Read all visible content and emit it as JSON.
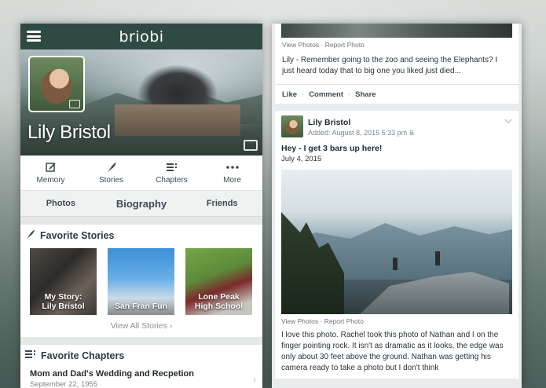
{
  "left": {
    "logo": "briobi",
    "profile_name": "Lily Bristol",
    "actions": [
      {
        "label": "Memory",
        "icon": "edit-icon"
      },
      {
        "label": "Stories",
        "icon": "quill-icon"
      },
      {
        "label": "Chapters",
        "icon": "chapters-icon"
      },
      {
        "label": "More",
        "icon": "more-icon"
      }
    ],
    "subtabs": [
      "Photos",
      "Biography",
      "Friends"
    ],
    "favorite_stories": {
      "heading": "Favorite Stories",
      "items": [
        {
          "line1": "My Story:",
          "line2": "Lily Bristol"
        },
        {
          "line1": "San Fran Fun",
          "line2": ""
        },
        {
          "line1": "Lone Peak",
          "line2": "High School"
        }
      ],
      "view_all": "View All Stories"
    },
    "favorite_chapters": {
      "heading": "Favorite Chapters",
      "items": [
        {
          "title": "Mom and Dad's Wedding and Recpetion",
          "date": "September 22, 1955"
        }
      ]
    }
  },
  "right": {
    "card1": {
      "view_photos": "View Photos",
      "report_photo": "Report Photo",
      "separator": "·",
      "caption": "Lily - Remember going to the zoo and seeing the Elephants? I just heard today that to big one you liked just died...",
      "actions": [
        "Like",
        "Comment",
        "Share"
      ]
    },
    "card2": {
      "author": "Lily Bristol",
      "added": "Added: August 8, 2015 5:33 pm",
      "title": "Hey - I get 3 bars up here!",
      "date": "July 4, 2015",
      "view_photos": "View Photos",
      "report_photo": "Report Photo",
      "separator": "·",
      "body": "I love this photo. Rachel took this photo of Nathan and I on the finger pointing rock. It isn't as dramatic as it looks, the edge was only about 30 feet above the ground. Nathan was getting his camera ready to take a photo but I don't think"
    }
  },
  "colors": {
    "topbar": "#2f4a42",
    "text_dark": "#1f2a33",
    "muted": "#7c858c"
  }
}
